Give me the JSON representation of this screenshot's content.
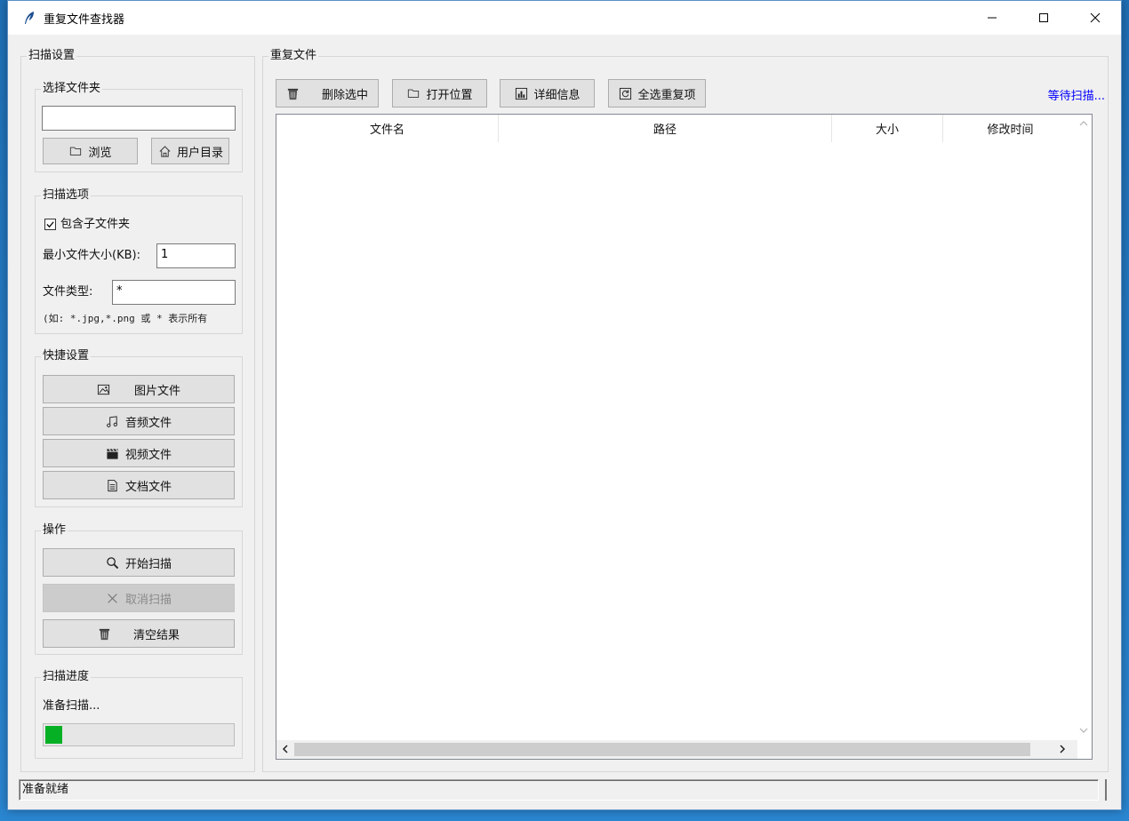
{
  "window": {
    "title": "重复文件查找器",
    "controls": {
      "minimize": "minimize-icon",
      "maximize": "maximize-icon",
      "close": "close-icon"
    }
  },
  "sidebar": {
    "group_title": "扫描设置",
    "folder": {
      "title": "选择文件夹",
      "path_value": "",
      "browse_label": "浏览",
      "home_label": "用户目录"
    },
    "options": {
      "title": "扫描选项",
      "include_subfolders_label": "包含子文件夹",
      "include_subfolders_checked": true,
      "min_size_label": "最小文件大小(KB):",
      "min_size_value": "1",
      "file_type_label": "文件类型:",
      "file_type_value": "*",
      "hint": "(如: *.jpg,*.png 或 * 表示所有"
    },
    "quick": {
      "title": "快捷设置",
      "images": "图片文件",
      "audio": "音频文件",
      "video": "视频文件",
      "docs": "文档文件"
    },
    "actions": {
      "title": "操作",
      "start": "开始扫描",
      "cancel": "取消扫描",
      "clear": "清空结果"
    },
    "progress": {
      "title": "扫描进度",
      "status": "准备扫描...",
      "value_fraction": 0.09
    }
  },
  "main": {
    "group_title": "重复文件",
    "toolbar": {
      "delete_selected": "删除选中",
      "open_location": "打开位置",
      "details": "详细信息",
      "select_dupes": "全选重复项"
    },
    "scan_status": "等待扫描...",
    "columns": [
      "文件名",
      "路径",
      "大小",
      "修改时间"
    ],
    "rows": []
  },
  "statusbar": {
    "text": "准备就绪"
  },
  "colors": {
    "progress": "#06b025",
    "link": "#0000ff"
  }
}
